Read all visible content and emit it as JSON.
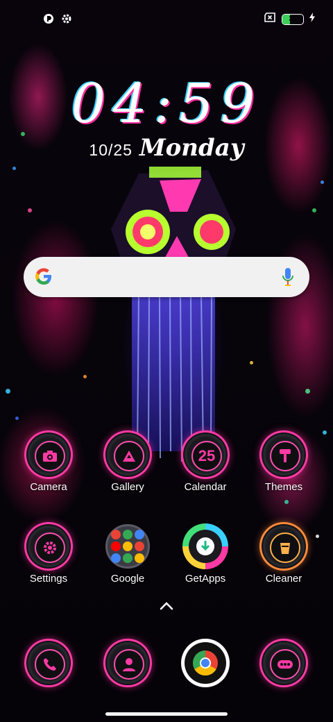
{
  "status_bar": {
    "left_icons": [
      "app-notification-icon",
      "settings-gear-icon"
    ],
    "right_icons": [
      "no-sim-icon",
      "battery-icon",
      "charging-bolt-icon"
    ],
    "battery_percent": "35",
    "battery_level": 0.35,
    "battery_color": "#3ccf5a"
  },
  "clock": {
    "time": "04:59",
    "date": "10/25",
    "day": "Monday"
  },
  "search": {
    "logo": "google-g-icon",
    "mic": "microphone-icon"
  },
  "apps": {
    "row1": [
      {
        "label": "Camera",
        "icon": "camera-icon"
      },
      {
        "label": "Gallery",
        "icon": "gallery-icon"
      },
      {
        "label": "Calendar",
        "icon": "calendar-icon",
        "badge_text": "25"
      },
      {
        "label": "Themes",
        "icon": "themes-icon"
      }
    ],
    "row2": [
      {
        "label": "Settings",
        "icon": "settings-icon"
      },
      {
        "label": "Google",
        "icon": "folder-icon"
      },
      {
        "label": "GetApps",
        "icon": "getapps-icon"
      },
      {
        "label": "Cleaner",
        "icon": "cleaner-icon"
      }
    ]
  },
  "drawer_handle_icon": "chevron-up-icon",
  "dock": [
    {
      "name": "phone",
      "icon": "phone-icon"
    },
    {
      "name": "contacts",
      "icon": "contacts-icon"
    },
    {
      "name": "chrome",
      "icon": "chrome-icon"
    },
    {
      "name": "messages",
      "icon": "messages-icon"
    }
  ],
  "colors": {
    "neon_accent": "#ff3aa4",
    "search_bg": "#f1f1f1"
  }
}
